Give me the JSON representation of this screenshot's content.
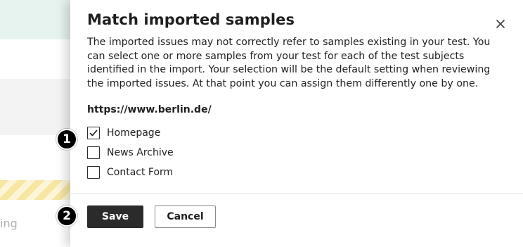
{
  "background_page": {
    "partial_text": "ing"
  },
  "dialog": {
    "title": "Match imported samples",
    "description": "The imported issues may not correctly refer to samples existing in your test. You can select one or more samples from your test for each of the test subjects identified in the import. Your selection will be the default setting when reviewing the imported issues. At that point you can assign them differently one by one.",
    "close_icon": "close-icon",
    "subject_url": "https://www.berlin.de/",
    "samples": [
      {
        "label": "Homepage",
        "checked": true
      },
      {
        "label": "News Archive",
        "checked": false
      },
      {
        "label": "Contact Form",
        "checked": false
      }
    ],
    "buttons": {
      "save_label": "Save",
      "cancel_label": "Cancel"
    }
  },
  "annotations": [
    {
      "number": "1"
    },
    {
      "number": "2"
    }
  ],
  "colors": {
    "primary_button": "#2b2b2b",
    "text": "#1f1f1f",
    "banner_teal": "#dceee9",
    "warning_stripe": "#f3dc7a"
  }
}
